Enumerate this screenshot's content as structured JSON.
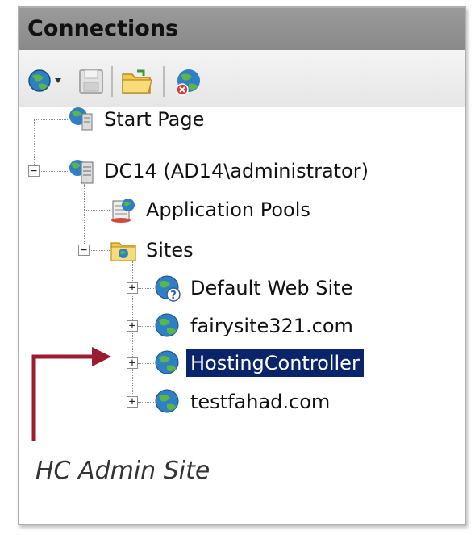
{
  "panel": {
    "title": "Connections"
  },
  "toolbar": {
    "icons": [
      "connect-icon",
      "save-icon",
      "folder-icon",
      "disconnect-icon"
    ]
  },
  "tree": {
    "start_page": "Start Page",
    "server": "DC14 (AD14\\administrator)",
    "app_pools": "Application Pools",
    "sites": "Sites",
    "site_items": [
      "Default Web Site",
      "fairysite321.com",
      "HostingController",
      "testfahad.com"
    ],
    "selected": "HostingController"
  },
  "annotation": {
    "text": "HC Admin Site",
    "color": "#9b1c2e"
  },
  "colors": {
    "titlebar": "#8f8f8f",
    "selection": "#0a246a",
    "arrow": "#9b1c2e"
  }
}
